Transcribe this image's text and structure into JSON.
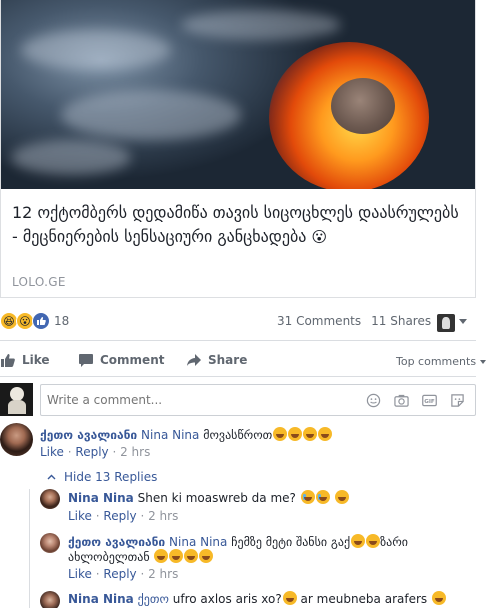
{
  "post": {
    "link_title": "12 ოქტომბერს დედამიწა თავის სიცოცხლეს დაასრულებს - მეცნიერების სენსაციური განცხადება",
    "link_emoji": "😮",
    "link_domain": "LOLO.GE"
  },
  "reactions": {
    "count": "18",
    "comments_count": "31 Comments",
    "shares_count": "11 Shares",
    "icons": [
      "haha",
      "wow",
      "like"
    ]
  },
  "actions": {
    "like_label": "Like",
    "comment_label": "Comment",
    "share_label": "Share",
    "sort_label": "Top comments"
  },
  "composer": {
    "placeholder": "Write a comment...",
    "icons": [
      "smiley-icon",
      "camera-icon",
      "gif-icon",
      "sticker-icon"
    ]
  },
  "comments": [
    {
      "author": "ქეთო ავალიანი",
      "tag": "Nina Nina",
      "text": "მოვასწროთ",
      "emoji_count": 4,
      "like": "Like",
      "reply": "Reply",
      "time": "2 hrs"
    }
  ],
  "hide_replies_label": "Hide 13 Replies",
  "replies": [
    {
      "author": "Nina Nina",
      "tag": "",
      "text": "Shen ki moaswreb da me?",
      "like": "Like",
      "reply": "Reply",
      "time": "2 hrs"
    },
    {
      "author": "ქეთო ავალიანი",
      "tag": "Nina Nina",
      "text": "ჩემზე მეტი შანსი გაქ",
      "text2": "ზარი",
      "line2": "ახლობელთან",
      "like": "Like",
      "reply": "Reply",
      "time": "2 hrs"
    },
    {
      "author": "Nina Nina",
      "tag": "ქეთო",
      "text": "ufro axlos aris xo?",
      "text2": "ar meubneba arafers"
    }
  ],
  "colors": {
    "link_blue": "#385898",
    "meta_gray": "#90949c",
    "like_blue": "#4267b2",
    "emoji_yellow": "#f7b928"
  }
}
